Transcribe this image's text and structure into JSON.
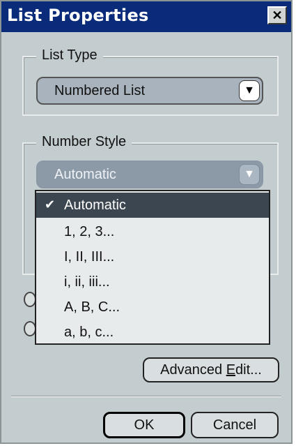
{
  "window": {
    "title": "List Properties",
    "close_glyph": "✕"
  },
  "list_type": {
    "group_label": "List Type",
    "selected": "Numbered List",
    "dropdown_icon": "triangle-down"
  },
  "number_style": {
    "group_label": "Number Style",
    "selected": "Automatic",
    "dropdown_icon": "triangle-down",
    "options": [
      "Automatic",
      "1, 2, 3...",
      "I, II, III...",
      "i, ii, iii...",
      "A, B, C...",
      "a, b, c..."
    ],
    "selected_index": 0,
    "check_glyph": "✔"
  },
  "buttons": {
    "advanced_prefix": "Advanced ",
    "advanced_mnemonic": "E",
    "advanced_suffix": "dit...",
    "ok": "OK",
    "cancel": "Cancel"
  },
  "colors": {
    "titlebar": "#0a2a7a",
    "dialog_bg": "#c3ccce",
    "highlight": "#3c4650"
  }
}
